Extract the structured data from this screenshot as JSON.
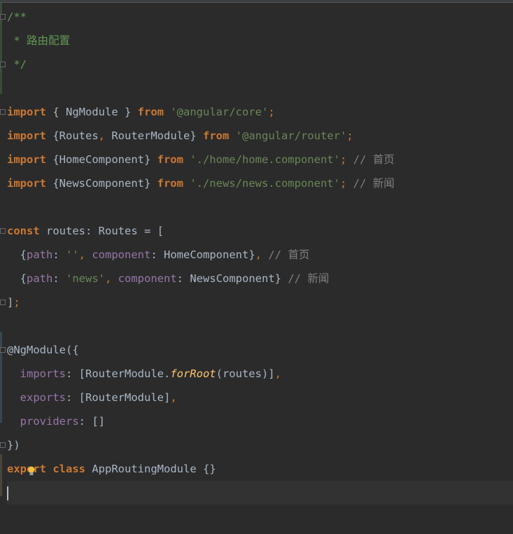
{
  "editor": {
    "language": "typescript",
    "colors": {
      "background": "#2b2b2b",
      "keyword": "#cc7832",
      "string": "#6a8759",
      "doc_comment": "#629755",
      "line_comment": "#808080",
      "text": "#a9b7c6",
      "property": "#9876aa",
      "function": "#ffc66d"
    },
    "current_line": 20,
    "lines": [
      [
        [
          "/**",
          "doc"
        ]
      ],
      [
        [
          " * 路由配置",
          "doc"
        ]
      ],
      [
        [
          " */",
          "doc"
        ]
      ],
      [],
      [
        [
          "import",
          "kw"
        ],
        [
          " { NgModule } ",
          "txt"
        ],
        [
          "from",
          "kw"
        ],
        [
          " ",
          "txt"
        ],
        [
          "'@angular/core'",
          "str"
        ],
        [
          ";",
          "pn"
        ]
      ],
      [
        [
          "import",
          "kw"
        ],
        [
          " {Routes",
          "txt"
        ],
        [
          ",",
          "pn"
        ],
        [
          " RouterModule} ",
          "txt"
        ],
        [
          "from",
          "kw"
        ],
        [
          " ",
          "txt"
        ],
        [
          "'@angular/router'",
          "str"
        ],
        [
          ";",
          "pn"
        ]
      ],
      [
        [
          "import",
          "kw"
        ],
        [
          " {HomeComponent} ",
          "txt"
        ],
        [
          "from",
          "kw"
        ],
        [
          " ",
          "txt"
        ],
        [
          "'./home/home.component'",
          "str"
        ],
        [
          ";",
          "pn"
        ],
        [
          " // 首页",
          "cmt"
        ]
      ],
      [
        [
          "import",
          "kw"
        ],
        [
          " {NewsComponent} ",
          "txt"
        ],
        [
          "from",
          "kw"
        ],
        [
          " ",
          "txt"
        ],
        [
          "'./news/news.component'",
          "str"
        ],
        [
          ";",
          "pn"
        ],
        [
          " // 新闻",
          "cmt"
        ]
      ],
      [],
      [
        [
          "const",
          "kw"
        ],
        [
          " routes: Routes = [",
          "txt"
        ]
      ],
      [
        [
          "  {",
          "txt"
        ],
        [
          "path",
          "prop"
        ],
        [
          ": ",
          "txt"
        ],
        [
          "''",
          "str"
        ],
        [
          ", ",
          "pn"
        ],
        [
          "component",
          "prop"
        ],
        [
          ": HomeComponent}",
          "txt"
        ],
        [
          ",",
          "pn"
        ],
        [
          " // 首页",
          "cmt"
        ]
      ],
      [
        [
          "  {",
          "txt"
        ],
        [
          "path",
          "prop"
        ],
        [
          ": ",
          "txt"
        ],
        [
          "'news'",
          "str"
        ],
        [
          ", ",
          "pn"
        ],
        [
          "component",
          "prop"
        ],
        [
          ": NewsComponent}",
          "txt"
        ],
        [
          " // 新闻",
          "cmt"
        ]
      ],
      [
        [
          "]",
          "txt"
        ],
        [
          ";",
          "pn"
        ]
      ],
      [],
      [
        [
          "@NgModule({",
          "txt"
        ]
      ],
      [
        [
          "  ",
          "txt"
        ],
        [
          "imports",
          "prop"
        ],
        [
          ": [RouterModule.",
          "txt"
        ],
        [
          "forRoot",
          "fn"
        ],
        [
          "(routes)]",
          "txt"
        ],
        [
          ",",
          "pn"
        ]
      ],
      [
        [
          "  ",
          "txt"
        ],
        [
          "exports",
          "prop"
        ],
        [
          ": [RouterModule]",
          "txt"
        ],
        [
          ",",
          "pn"
        ]
      ],
      [
        [
          "  ",
          "txt"
        ],
        [
          "providers",
          "prop"
        ],
        [
          ": []",
          "txt"
        ]
      ],
      [
        [
          "})",
          "txt"
        ]
      ],
      [
        [
          "export",
          "kw"
        ],
        [
          " ",
          "txt"
        ],
        [
          "class",
          "kw"
        ],
        [
          " AppRoutingModule {}",
          "txt"
        ]
      ],
      []
    ]
  }
}
